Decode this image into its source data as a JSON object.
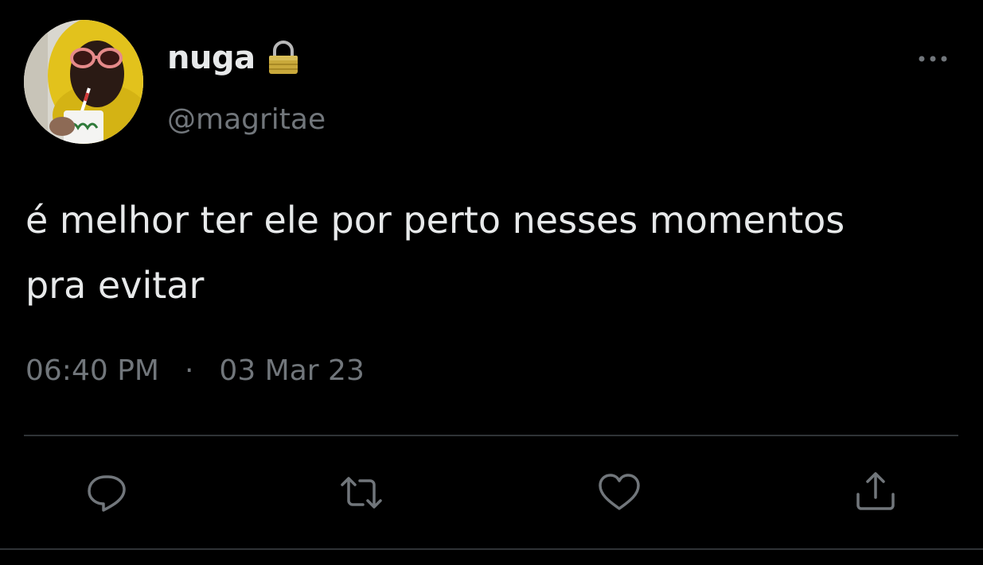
{
  "author": {
    "display_name": "nuga",
    "handle": "@magritae",
    "protected_icon": "lock-icon",
    "avatar_description_icon": "avatar"
  },
  "tweet": {
    "text_line1": "é melhor ter ele por perto nesses momentos",
    "text_line2": "pra evitar",
    "time": "06:40 PM",
    "separator": "·",
    "date": "03 Mar 23"
  },
  "actions": {
    "reply_icon": "reply-icon",
    "retweet_icon": "retweet-icon",
    "like_icon": "heart-icon",
    "share_icon": "share-icon",
    "more_icon": "more-options-icon"
  },
  "colors": {
    "background": "#000000",
    "text_primary": "#e7e9ea",
    "text_secondary": "#71767b",
    "divider": "#2f3336",
    "lock": "#c9a93b"
  }
}
